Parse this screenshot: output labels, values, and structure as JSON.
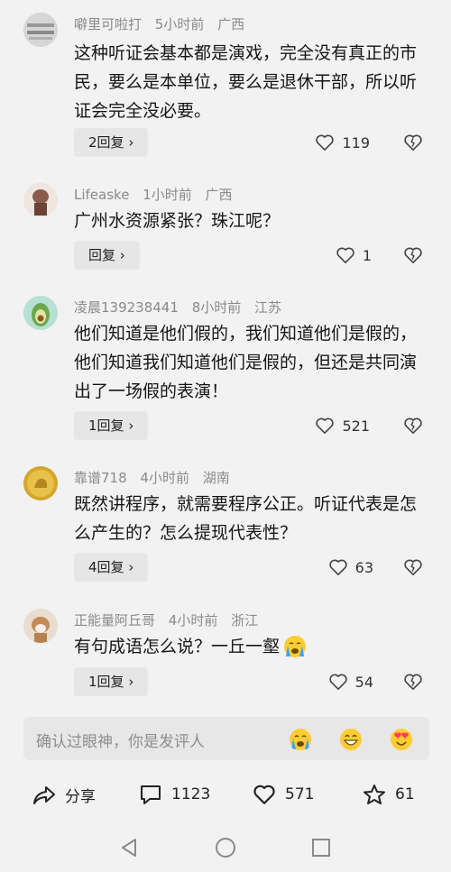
{
  "comments": [
    {
      "username": "噼里可啦打",
      "time": "5小时前",
      "location": "广西",
      "text": "这种听证会基本都是演戏，完全没有真正的市民，要么是本单位，要么是退休干部，所以听证会完全没必要。",
      "reply_label": "2回复",
      "likes": "119",
      "avatar_color": "#cfcfcf"
    },
    {
      "username": "Lifeaske",
      "time": "1小时前",
      "location": "广西",
      "text": "广州水资源紧张？珠江呢？",
      "reply_label": "回复",
      "likes": "1",
      "avatar_color": "#b58b7a"
    },
    {
      "username": "凌晨139238441",
      "time": "8小时前",
      "location": "江苏",
      "text": "他们知道是他们假的，我们知道他们是假的，他们知道我们知道他们是假的，但还是共同演出了一场假的表演！",
      "reply_label": "1回复",
      "likes": "521",
      "avatar_color": "#a9d7c9"
    },
    {
      "username": "靠谱718",
      "time": "4小时前",
      "location": "湖南",
      "text": "既然讲程序，就需要程序公正。听证代表是怎么产生的？怎么提现代表性？",
      "reply_label": "4回复",
      "likes": "63",
      "avatar_color": "#d9ad2b"
    },
    {
      "username": "正能量阿丘哥",
      "time": "4小时前",
      "location": "浙江",
      "text": "有句成语怎么说？一丘一壑",
      "reply_label": "1回复",
      "likes": "54",
      "avatar_color": "#c9a584"
    }
  ],
  "input": {
    "placeholder": "确认过眼神，你是发评人"
  },
  "bottom": {
    "share_label": "分享",
    "comments_count": "1123",
    "likes_count": "571",
    "favorites_count": "61"
  }
}
